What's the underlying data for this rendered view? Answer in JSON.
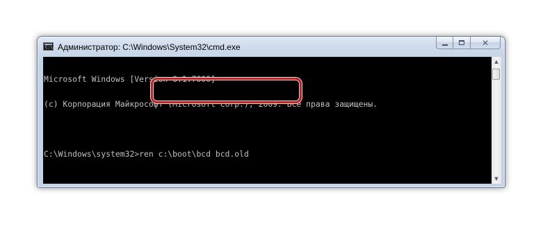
{
  "window": {
    "title": "Администратор: C:\\Windows\\System32\\cmd.exe",
    "icon": "cmd-icon",
    "controls": {
      "minimize": "minimize-icon",
      "maximize": "maximize-icon",
      "close": "✕"
    }
  },
  "console": {
    "lines": [
      "Microsoft Windows [Version 6.1.7600]",
      "(c) Корпорация Майкрософт (Microsoft Corp.), 2009. Все права защищены.",
      "",
      "C:\\Windows\\system32>ren c:\\boot\\bcd bcd.old"
    ],
    "text_color": "#c0c0c0",
    "background_color": "#000000"
  },
  "scrollbar": {
    "up_arrow": "▲",
    "down_arrow": "▼"
  },
  "annotation": {
    "color": "#d11a1a",
    "shape": "rounded-rectangle"
  }
}
